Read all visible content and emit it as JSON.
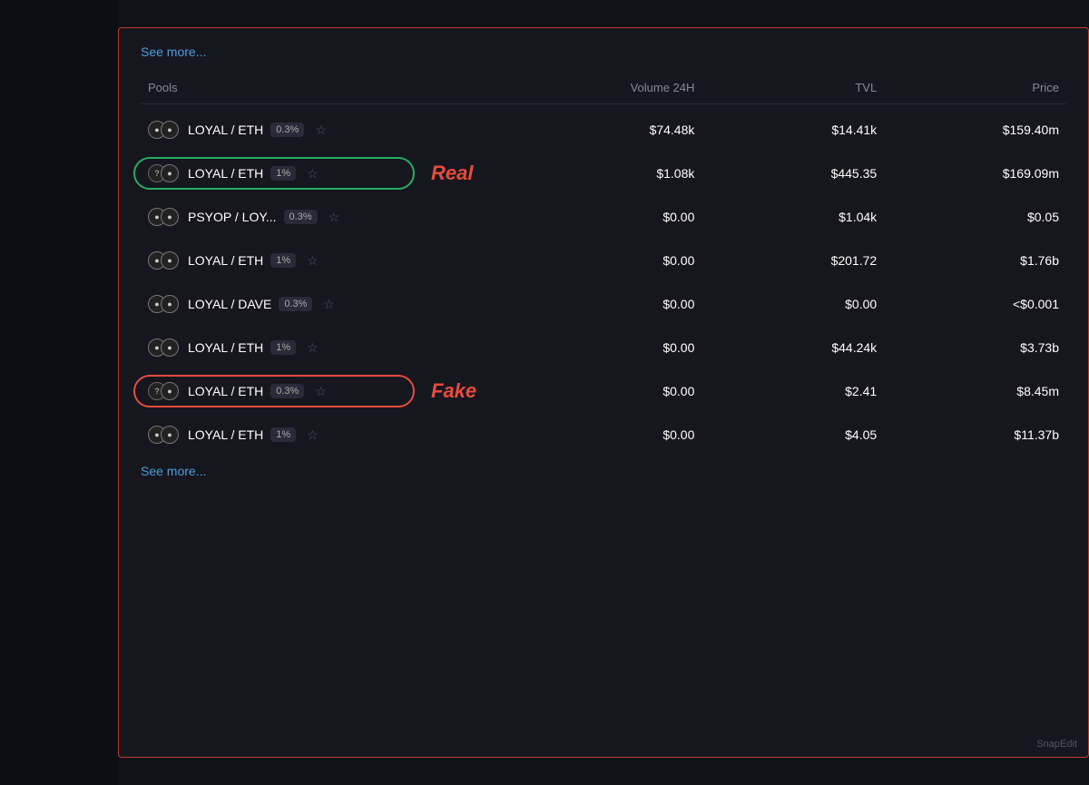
{
  "header": {
    "see_more_top": "See more...",
    "see_more_bottom": "See more..."
  },
  "table": {
    "columns": {
      "pools": "Pools",
      "volume_24h": "Volume 24H",
      "tvl": "TVL",
      "price": "Price"
    },
    "rows": [
      {
        "id": "row-1",
        "pair": "LOYAL / ETH",
        "fee": "0.3%",
        "volume": "$74.48k",
        "tvl": "$14.41k",
        "price": "$159.40m",
        "highlight": "none",
        "icon1_type": "circle",
        "icon2_type": "circle"
      },
      {
        "id": "row-2",
        "pair": "LOYAL / ETH",
        "fee": "1%",
        "volume": "$1.08k",
        "tvl": "$445.35",
        "price": "$169.09m",
        "highlight": "green",
        "label": "Real",
        "icon1_type": "question",
        "icon2_type": "circle"
      },
      {
        "id": "row-3",
        "pair": "PSYOP / LOY...",
        "fee": "0.3%",
        "volume": "$0.00",
        "tvl": "$1.04k",
        "price": "$0.05",
        "highlight": "none",
        "icon1_type": "circle",
        "icon2_type": "circle"
      },
      {
        "id": "row-4",
        "pair": "LOYAL / ETH",
        "fee": "1%",
        "volume": "$0.00",
        "tvl": "$201.72",
        "price": "$1.76b",
        "highlight": "none",
        "icon1_type": "circle",
        "icon2_type": "circle"
      },
      {
        "id": "row-5",
        "pair": "LOYAL / DAVE",
        "fee": "0.3%",
        "volume": "$0.00",
        "tvl": "$0.00",
        "price": "<$0.001",
        "highlight": "none",
        "icon1_type": "circle",
        "icon2_type": "circle"
      },
      {
        "id": "row-6",
        "pair": "LOYAL / ETH",
        "fee": "1%",
        "volume": "$0.00",
        "tvl": "$44.24k",
        "price": "$3.73b",
        "highlight": "none",
        "icon1_type": "circle",
        "icon2_type": "circle"
      },
      {
        "id": "row-7",
        "pair": "LOYAL / ETH",
        "fee": "0.3%",
        "volume": "$0.00",
        "tvl": "$2.41",
        "price": "$8.45m",
        "highlight": "red",
        "label": "Fake",
        "icon1_type": "question",
        "icon2_type": "circle"
      },
      {
        "id": "row-8",
        "pair": "LOYAL / ETH",
        "fee": "1%",
        "volume": "$0.00",
        "tvl": "$4.05",
        "price": "$11.37b",
        "highlight": "none",
        "icon1_type": "circle",
        "icon2_type": "circle"
      }
    ]
  },
  "watermark": "SnapEdit"
}
